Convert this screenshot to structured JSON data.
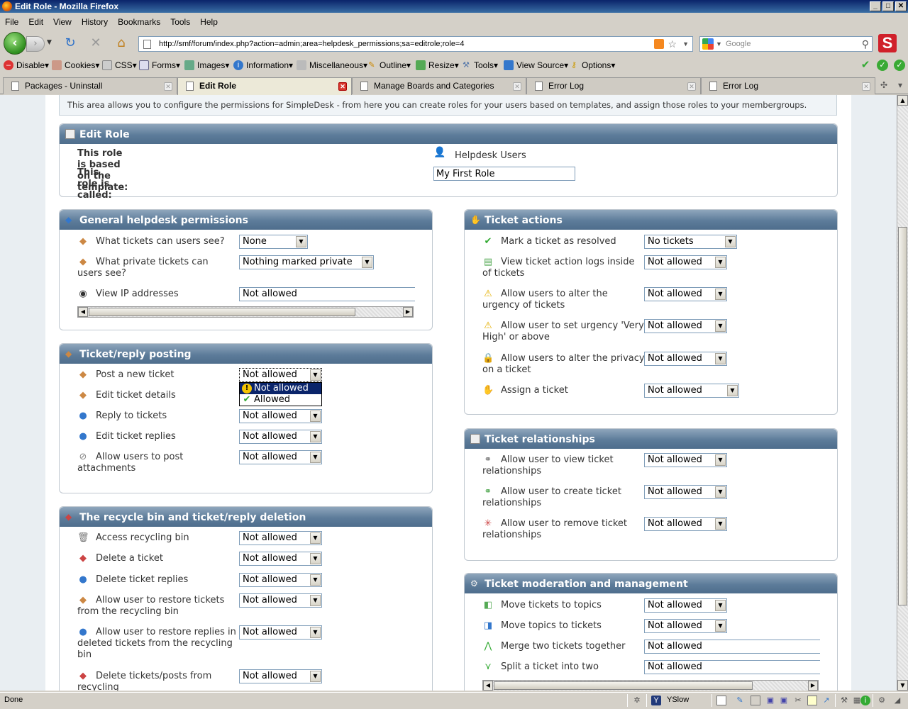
{
  "window": {
    "title": "Edit Role - Mozilla Firefox"
  },
  "menu": [
    "File",
    "Edit",
    "View",
    "History",
    "Bookmarks",
    "Tools",
    "Help"
  ],
  "nav": {
    "url": "http://smf/forum/index.php?action=admin;area=helpdesk_permissions;sa=editrole;role=4",
    "search_placeholder": "Google"
  },
  "devtoolbar": [
    "Disable",
    "Cookies",
    "CSS",
    "Forms",
    "Images",
    "Information",
    "Miscellaneous",
    "Outline",
    "Resize",
    "Tools",
    "View Source",
    "Options"
  ],
  "tabs": [
    "Packages - Uninstall",
    "Edit Role",
    "Manage Boards and Categories",
    "Error Log",
    "Error Log"
  ],
  "info": "This area allows you to configure the permissions for SimpleDesk - from here you can create roles for your users based on templates, and assign those roles to your membergroups.",
  "edit_role": {
    "title": "Edit Role",
    "template_label": "This role is based on the template:",
    "template_value": "Helpdesk Users",
    "called_label": "This role is called:",
    "called_value": "My First Role"
  },
  "general": {
    "title": "General helpdesk permissions",
    "rows": [
      {
        "label": "What tickets can users see?",
        "value": "None"
      },
      {
        "label": "What private tickets can users see?",
        "value": "Nothing marked private"
      },
      {
        "label": "View IP addresses",
        "value": "Not allowed"
      }
    ]
  },
  "posting": {
    "title": "Ticket/reply posting",
    "rows": [
      {
        "label": "Post a new ticket",
        "value": "Not allowed"
      },
      {
        "label": "Edit ticket details",
        "value": "Not allowed"
      },
      {
        "label": "Reply to tickets",
        "value": "Not allowed"
      },
      {
        "label": "Edit ticket replies",
        "value": "Not allowed"
      },
      {
        "label": "Allow users to post attachments",
        "value": "Not allowed"
      }
    ],
    "dropdown": [
      "Not allowed",
      "Allowed"
    ]
  },
  "recycle": {
    "title": "The recycle bin and ticket/reply deletion",
    "rows": [
      {
        "label": "Access recycling bin",
        "value": "Not allowed"
      },
      {
        "label": "Delete a ticket",
        "value": "Not allowed"
      },
      {
        "label": "Delete ticket replies",
        "value": "Not allowed"
      },
      {
        "label": "Allow user to restore tickets from the recycling bin",
        "value": "Not allowed"
      },
      {
        "label": "Allow user to restore replies in deleted tickets from the recycling bin",
        "value": "Not allowed"
      },
      {
        "label": "Delete tickets/posts from recycling",
        "value": "Not allowed"
      }
    ]
  },
  "actions": {
    "title": "Ticket actions",
    "rows": [
      {
        "label": "Mark a ticket as resolved",
        "value": "No tickets"
      },
      {
        "label": "View ticket action logs inside of tickets",
        "value": "Not allowed"
      },
      {
        "label": "Allow users to alter the urgency of tickets",
        "value": "Not allowed"
      },
      {
        "label": "Allow user to set urgency 'Very High' or above",
        "value": "Not allowed"
      },
      {
        "label": "Allow users to alter the privacy on a ticket",
        "value": "Not allowed"
      },
      {
        "label": "Assign a ticket",
        "value": "Not allowed"
      }
    ]
  },
  "relationships": {
    "title": "Ticket relationships",
    "rows": [
      {
        "label": "Allow user to view ticket relationships",
        "value": "Not allowed"
      },
      {
        "label": "Allow user to create ticket relationships",
        "value": "Not allowed"
      },
      {
        "label": "Allow user to remove ticket relationships",
        "value": "Not allowed"
      }
    ]
  },
  "moderation": {
    "title": "Ticket moderation and management",
    "rows": [
      {
        "label": "Move tickets to topics",
        "value": "Not allowed"
      },
      {
        "label": "Move topics to tickets",
        "value": "Not allowed"
      },
      {
        "label": "Merge two tickets together",
        "value": "Not allowed"
      },
      {
        "label": "Split a ticket into two",
        "value": "Not allowed"
      }
    ]
  },
  "status": {
    "text": "Done",
    "yslow": "YSlow"
  }
}
